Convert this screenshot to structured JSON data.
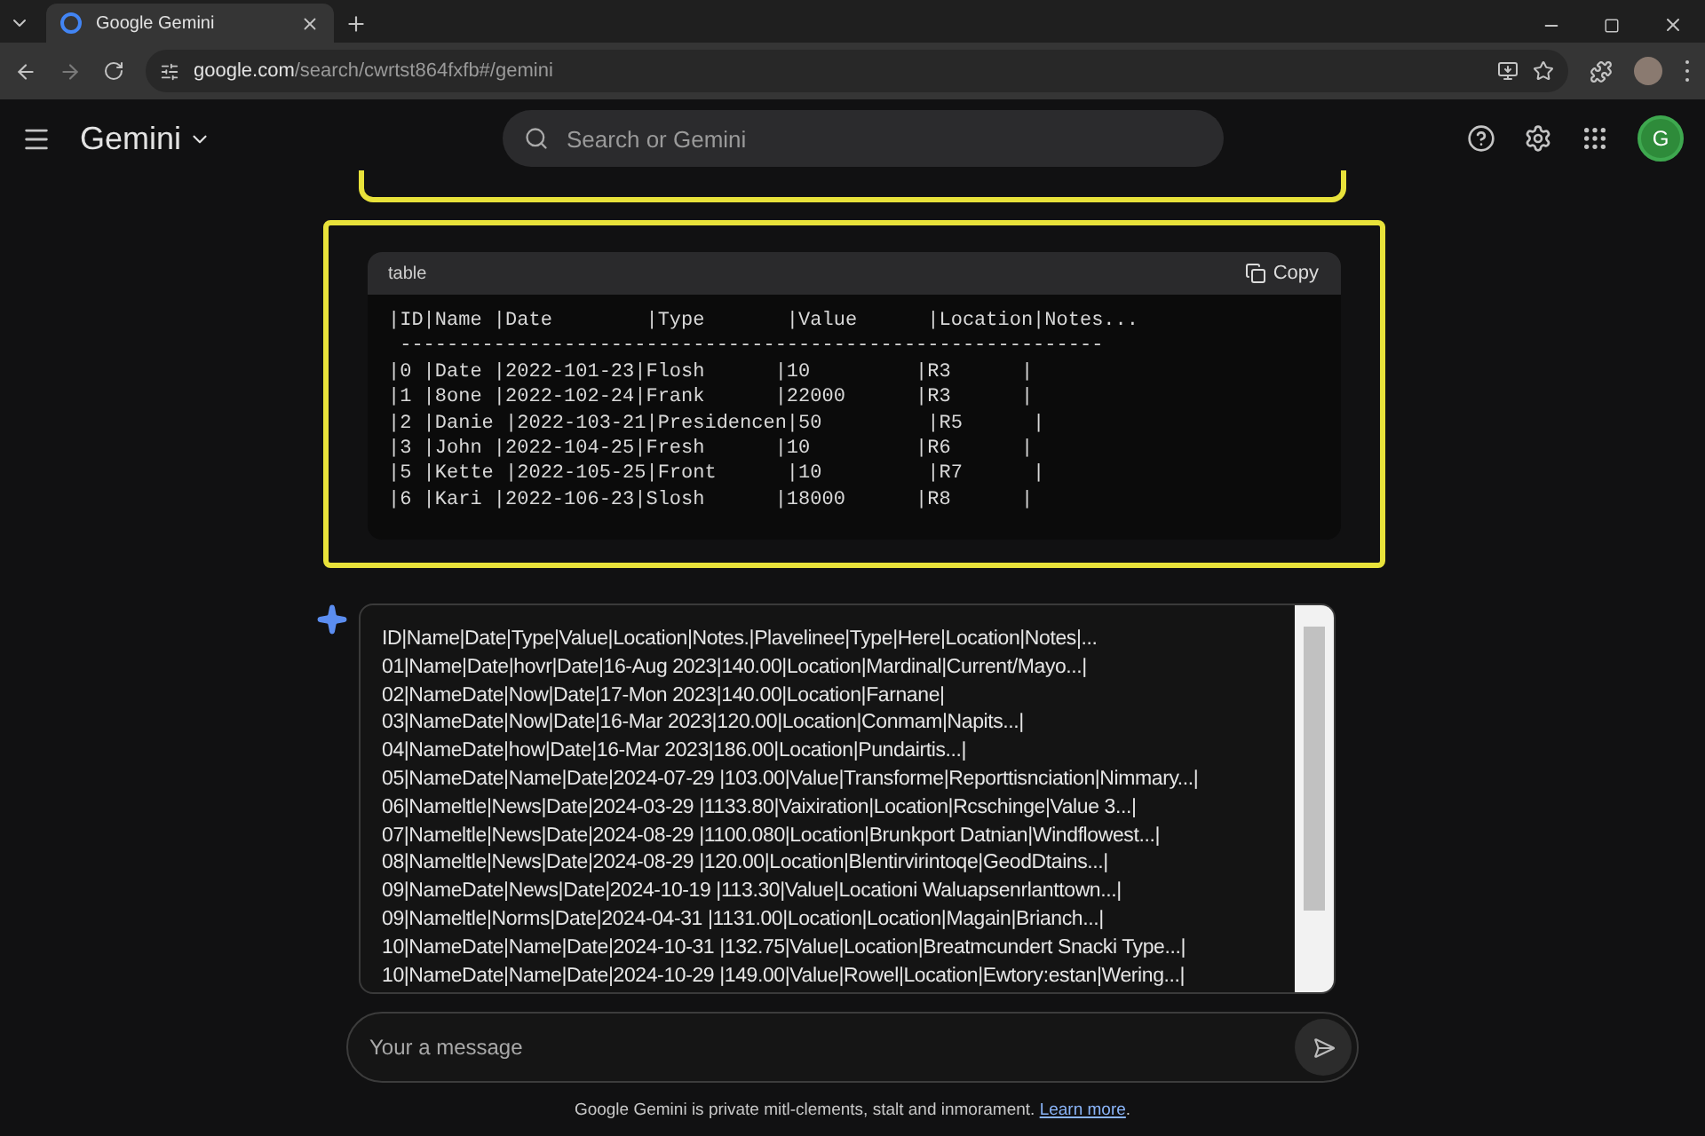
{
  "browser": {
    "tab_title": "Google Gemini",
    "url_host": "google.com",
    "url_path": "/search/cwrtst864fxfb#/gemini"
  },
  "header": {
    "app_name": "Gemini",
    "search": {
      "placeholder": "Search or Gemini"
    },
    "avatar_letter": "G"
  },
  "code_block": {
    "language": "table",
    "copy_label": "Copy",
    "lines": [
      "|ID|Name |Date        |Type       |Value      |Location|Notes...",
      " ------------------------------------------------------------",
      "|0 |Date |2022-101-23|Flosh      |10         |R3      |",
      "|1 |8one |2022-102-24|Frank      |22000      |R3      |",
      "|2 |Danie |2022-103-21|Presidencen|50         |R5      |",
      "|3 |John |2022-104-25|Fresh      |10         |R6      |",
      "|5 |Kette |2022-105-25|Front      |10         |R7      |",
      "|6 |Kari |2022-106-23|Slosh      |18000      |R8      |"
    ]
  },
  "response": {
    "lines": [
      "ID|Name|Date|Type|Value|Location|Notes.|Plavelinee|Type|Here|Location|Notes|...",
      "01|Name|Date|hovr|Date|16-Aug 2023|140.00|Location|Mardinal|Current/Mayo...|",
      "02|NameDate|Now|Date|17-Mon 2023|140.00|Location|Farnane|",
      "03|NameDate|Now|Date|16-Mar 2023|120.00|Location|Conmam|Napits...|",
      "04|NameDate|how|Date|16-Mar 2023|186.00|Location|Pundairtis...|",
      "05|NameDate|Name|Date|2024-07-29 |103.00|Value|Transforme|Reporttisnciation|Nimmary...|",
      "06|Nameltle|News|Date|2024-03-29 |1133.80|Vaixiration|Location|Rcschinge|Value 3...|",
      "07|Nameltle|News|Date|2024-08-29 |1100.080|Location|Brunkport Datnian|Windflowest...|",
      "08|Nameltle|News|Date|2024-08-29 |120.00|Location|Blentirvirintoqe|GeodDtains...|",
      "09|NameDate|News|Date|2024-10-19 |113.30|Value|Locationi Waluapsenrlanttown...|",
      "09|Nameltle|Norms|Date|2024-04-31 |1131.00|Location|Location|Magain|Brianch...|",
      "10|NameDate|Name|Date|2024-10-31 |132.75|Value|Location|Breatmcundert Snacki Type...|",
      "10|NameDate|Name|Date|2024-10-29 |149.00|Value|Rowel|Location|Ewtory:estan|Wering...|"
    ]
  },
  "composer": {
    "placeholder": "Your a message"
  },
  "footer": {
    "text": "Google Gemini is private mitl-clements, stalt and inmorament.",
    "link": "Learn more",
    "suffix": "."
  }
}
